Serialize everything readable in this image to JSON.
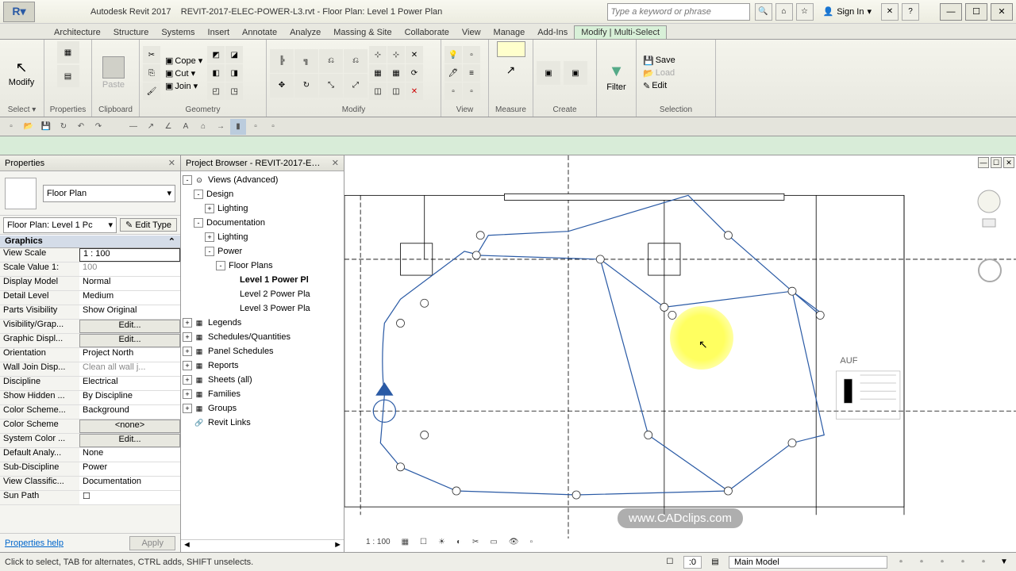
{
  "titlebar": {
    "app": "Autodesk Revit 2017",
    "doc": "REVIT-2017-ELEC-POWER-L3.rvt - Floor Plan: Level 1 Power Plan",
    "search_placeholder": "Type a keyword or phrase",
    "signin": "Sign In"
  },
  "ribbon": {
    "tabs": [
      "Architecture",
      "Structure",
      "Systems",
      "Insert",
      "Annotate",
      "Analyze",
      "Massing & Site",
      "Collaborate",
      "View",
      "Manage",
      "Add-Ins",
      "Modify | Multi-Select"
    ],
    "active_tab": 11,
    "panels": {
      "select": {
        "title": "Select ▾",
        "btn": "Modify"
      },
      "properties": {
        "title": "Properties"
      },
      "clipboard": {
        "title": "Clipboard",
        "paste": "Paste",
        "cope": "Cope ▾",
        "cut": "Cut ▾",
        "join": "Join ▾"
      },
      "geometry": {
        "title": "Geometry"
      },
      "modify": {
        "title": "Modify"
      },
      "view": {
        "title": "View"
      },
      "measure": {
        "title": "Measure"
      },
      "create": {
        "title": "Create"
      },
      "filter": {
        "title": "",
        "btn": "Filter"
      },
      "selection": {
        "title": "Selection",
        "save": "Save",
        "load": "Load",
        "edit": "Edit"
      }
    }
  },
  "properties": {
    "title": "Properties",
    "type": "Floor Plan",
    "instance": "Floor Plan: Level 1 Pc",
    "edit_type": "Edit Type",
    "group": "Graphics",
    "rows": [
      {
        "k": "View Scale",
        "v": "1 : 100",
        "sel": true
      },
      {
        "k": "Scale Value    1:",
        "v": "100",
        "dim": true
      },
      {
        "k": "Display Model",
        "v": "Normal"
      },
      {
        "k": "Detail Level",
        "v": "Medium"
      },
      {
        "k": "Parts Visibility",
        "v": "Show Original"
      },
      {
        "k": "Visibility/Grap...",
        "v": "Edit...",
        "btn": true
      },
      {
        "k": "Graphic Displ...",
        "v": "Edit...",
        "btn": true
      },
      {
        "k": "Orientation",
        "v": "Project North"
      },
      {
        "k": "Wall Join Disp...",
        "v": "Clean all wall j...",
        "dim": true
      },
      {
        "k": "Discipline",
        "v": "Electrical"
      },
      {
        "k": "Show Hidden ...",
        "v": "By Discipline"
      },
      {
        "k": "Color Scheme...",
        "v": "Background"
      },
      {
        "k": "Color Scheme",
        "v": "<none>",
        "btn": true
      },
      {
        "k": "System Color ...",
        "v": "Edit...",
        "btn": true
      },
      {
        "k": "Default Analy...",
        "v": "None"
      },
      {
        "k": "Sub-Discipline",
        "v": "Power"
      },
      {
        "k": "View Classific...",
        "v": "Documentation"
      },
      {
        "k": "Sun Path",
        "v": "☐"
      }
    ],
    "help": "Properties help",
    "apply": "Apply"
  },
  "browser": {
    "title": "Project Browser - REVIT-2017-ELE...",
    "items": [
      {
        "depth": 0,
        "exp": "-",
        "icon": "⊙",
        "label": "Views (Advanced)"
      },
      {
        "depth": 1,
        "exp": "-",
        "label": "Design"
      },
      {
        "depth": 2,
        "exp": "+",
        "label": "Lighting"
      },
      {
        "depth": 1,
        "exp": "-",
        "label": "Documentation"
      },
      {
        "depth": 2,
        "exp": "+",
        "label": "Lighting"
      },
      {
        "depth": 2,
        "exp": "-",
        "label": "Power"
      },
      {
        "depth": 3,
        "exp": "-",
        "label": "Floor Plans"
      },
      {
        "depth": 4,
        "label": "Level 1 Power Pl",
        "sel": true
      },
      {
        "depth": 4,
        "label": "Level 2 Power Pla"
      },
      {
        "depth": 4,
        "label": "Level 3 Power Pla"
      },
      {
        "depth": 0,
        "exp": "+",
        "icon": "▦",
        "label": "Legends"
      },
      {
        "depth": 0,
        "exp": "+",
        "icon": "▦",
        "label": "Schedules/Quantities"
      },
      {
        "depth": 0,
        "exp": "+",
        "icon": "▦",
        "label": "Panel Schedules"
      },
      {
        "depth": 0,
        "exp": "+",
        "icon": "▦",
        "label": "Reports"
      },
      {
        "depth": 0,
        "exp": "+",
        "icon": "▦",
        "label": "Sheets (all)"
      },
      {
        "depth": 0,
        "exp": "+",
        "icon": "▦",
        "label": "Families"
      },
      {
        "depth": 0,
        "exp": "+",
        "icon": "▦",
        "label": "Groups"
      },
      {
        "depth": 0,
        "icon": "🔗",
        "label": "Revit Links"
      }
    ]
  },
  "canvas": {
    "scale": "1 : 100",
    "watermark": "www.CADclips.com",
    "annot": "AUF"
  },
  "status": {
    "hint": "Click to select, TAB for alternates, CTRL adds, SHIFT unselects.",
    "zero": ":0",
    "model": "Main Model"
  }
}
